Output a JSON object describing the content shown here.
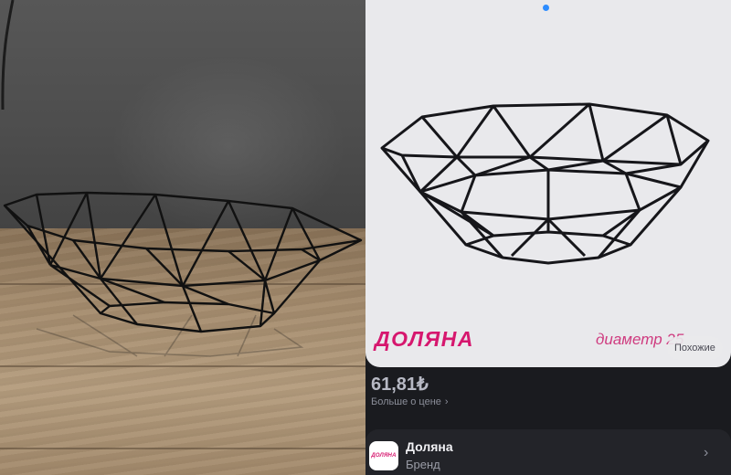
{
  "product": {
    "brand_logo": "ДОЛЯНА",
    "image_caption": "диаметр 25",
    "similar_button": "Похожие",
    "price": "61,81₺",
    "price_more_link": "Больше о цене",
    "carousel_active_index": 1
  },
  "brand": {
    "avatar_text": "ДОЛЯНА",
    "name": "Доляна",
    "type": "Бренд"
  },
  "colors": {
    "accent_pink": "#d6176e",
    "carousel_dot": "#2d8cff",
    "panel_background": "#1a1b1f"
  },
  "icons": {
    "price_chevron": "chevron-right-icon",
    "brand_chevron": "chevron-right-icon"
  }
}
